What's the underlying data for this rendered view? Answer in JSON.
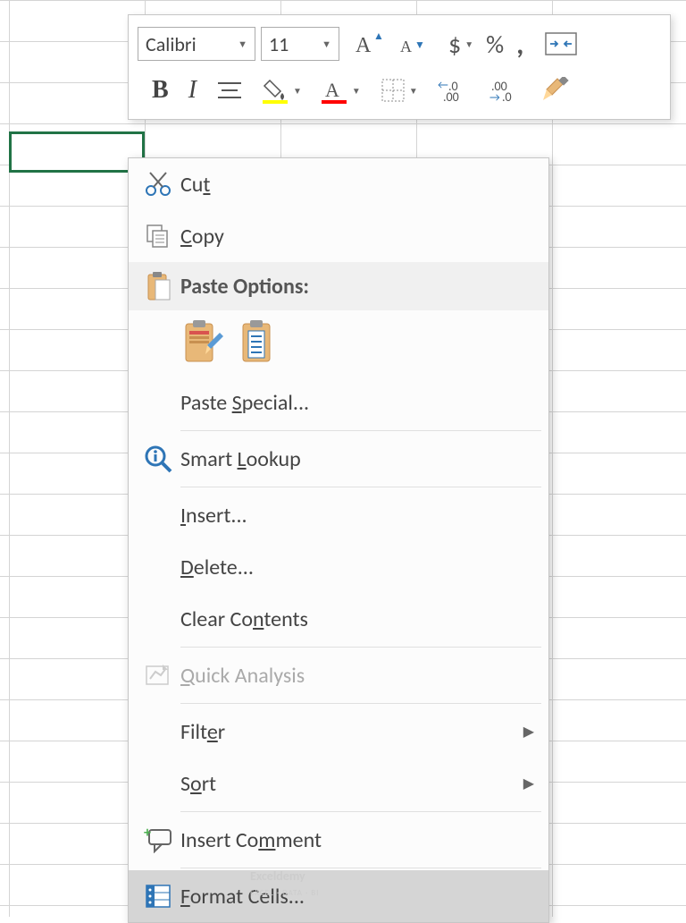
{
  "toolbar": {
    "font_name": "Calibri",
    "font_size": "11",
    "currency": "$",
    "percent": "%",
    "comma": ","
  },
  "menu": {
    "cut": "Cut",
    "copy": "Copy",
    "paste_options": "Paste Options:",
    "paste_special": "Paste Special...",
    "smart_lookup": "Smart Lookup",
    "insert": "Insert...",
    "delete": "Delete...",
    "clear_contents": "Clear Contents",
    "quick_analysis": "Quick Analysis",
    "filter": "Filter",
    "sort": "Sort",
    "insert_comment": "Insert Comment",
    "format_cells": "Format Cells..."
  },
  "watermark": {
    "main": "Exceldemy",
    "sub": "EXCEL · DATA · BI"
  }
}
